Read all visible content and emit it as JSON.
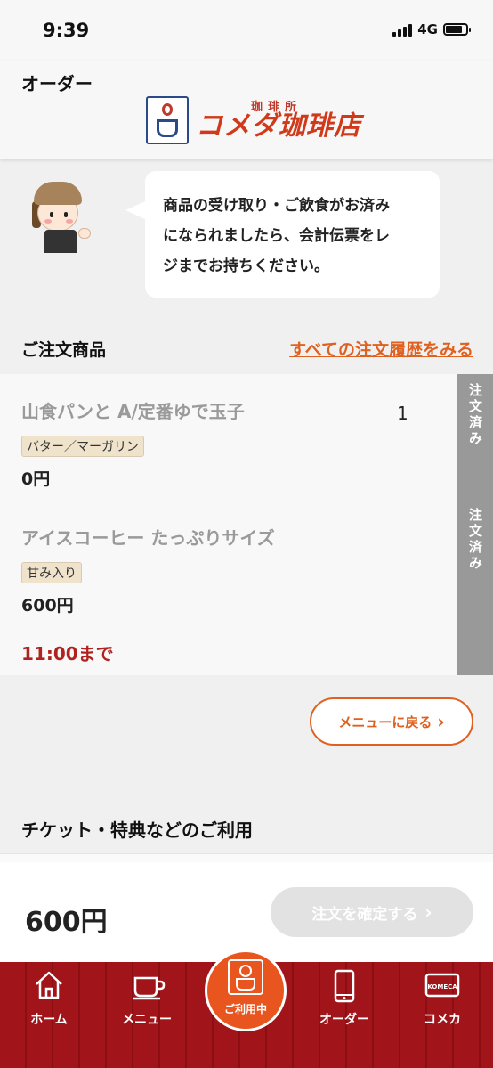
{
  "status": {
    "time": "9:39",
    "network": "4G"
  },
  "header": {
    "title": "オーダー",
    "logo_sub": "珈琲所",
    "logo_main": "コメダ珈琲店"
  },
  "bubble": {
    "line1": "商品の受け取り・ご飲食がお済み",
    "line2": "になられましたら、会計伝票をレ",
    "line3": "ジまでお持ちください。"
  },
  "orders": {
    "title": "ご注文商品",
    "history_link": "すべての注文履歴をみる",
    "items": [
      {
        "name": "山食パンと A/定番ゆで玉子",
        "option": "バター／マーガリン",
        "price": "0円",
        "quantity": "1",
        "status": "注文済み"
      },
      {
        "name": "アイスコーヒー たっぷりサイズ",
        "option": "甘み入り",
        "price": "600円",
        "status": "注文済み"
      }
    ],
    "deadline": "11:00まで"
  },
  "back_button": {
    "label": "メニューに戻る"
  },
  "tickets": {
    "title": "チケット・特典などのご利用"
  },
  "footer": {
    "total": "600円",
    "confirm_label": "注文を確定する",
    "confirm_disabled": true
  },
  "tabbar": {
    "items": [
      {
        "label": "ホーム",
        "icon": "home-icon"
      },
      {
        "label": "メニュー",
        "icon": "coffee-cup-icon"
      },
      {
        "label": "ご利用中",
        "icon": "komeda-logo-icon"
      },
      {
        "label": "オーダー",
        "icon": "smartphone-icon"
      },
      {
        "label": "コメカ",
        "icon": "komeca-card-icon"
      }
    ],
    "card_text": "KOMECA"
  },
  "colors": {
    "accent": "#e0611f",
    "brand_red": "#a0141a",
    "deadline": "#b0221e",
    "status_strip": "#999999"
  }
}
